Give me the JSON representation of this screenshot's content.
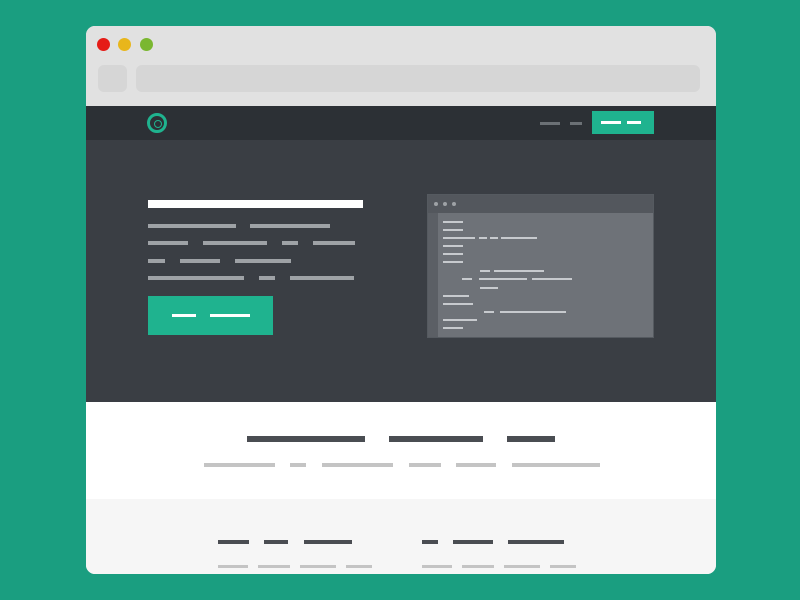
{
  "browser": {
    "traffic_lights": [
      "close",
      "minimize",
      "maximize"
    ],
    "colors": {
      "close": "#e51c17",
      "minimize": "#e8b61b",
      "maximize": "#7ab730"
    }
  },
  "site": {
    "logo_icon": "circle-logo-icon",
    "accent_color": "#1fb38f",
    "nav_links": 2
  },
  "editor": {
    "window_dots": 3,
    "line_count": 16
  },
  "icons": [
    "close-icon",
    "minimize-icon",
    "maximize-icon",
    "circle-logo-icon"
  ]
}
